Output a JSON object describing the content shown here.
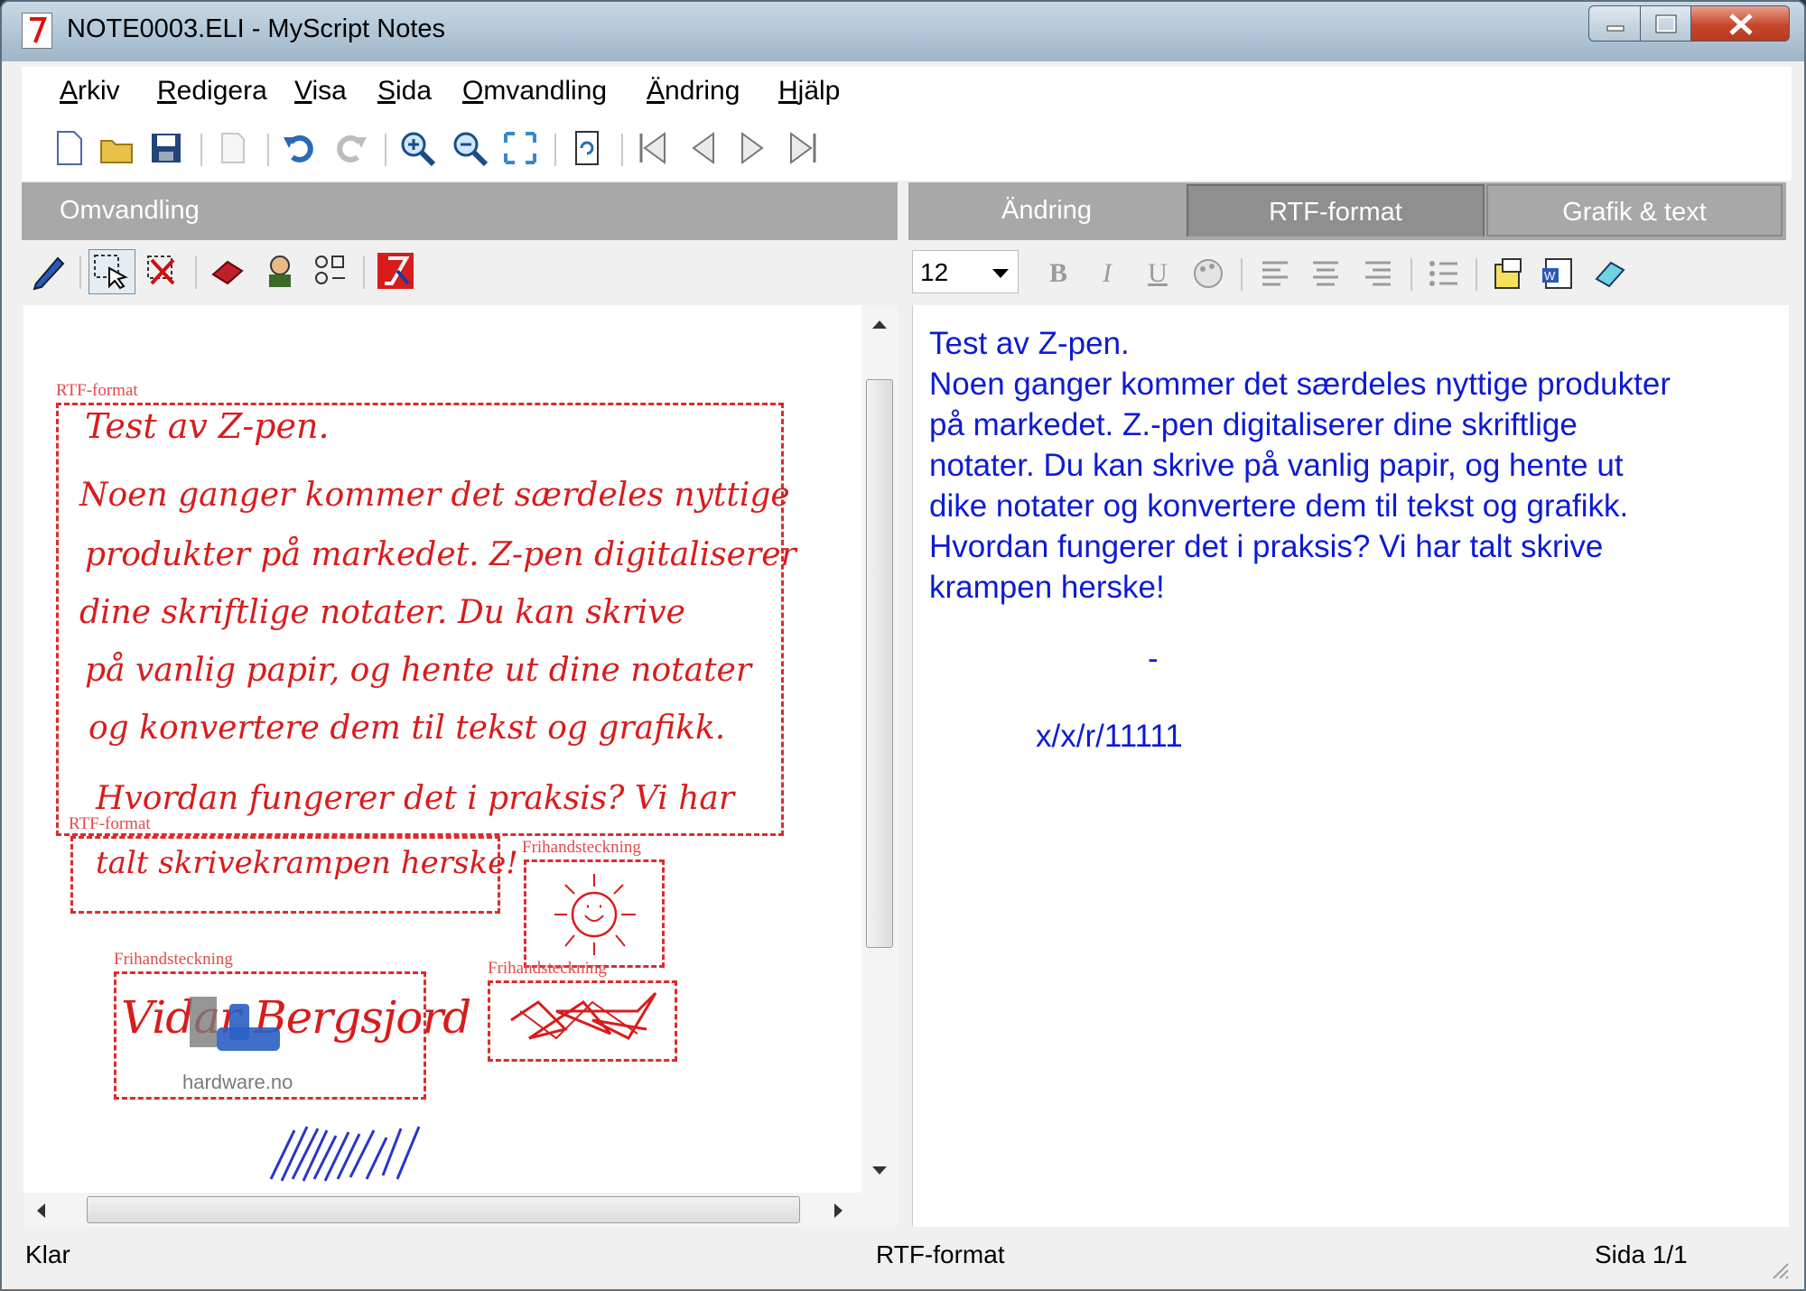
{
  "window": {
    "title": "NOTE0003.ELI - MyScript Notes"
  },
  "menu": [
    "Arkiv",
    "Redigera",
    "Visa",
    "Sida",
    "Omvandling",
    "Ändring",
    "Hjälp"
  ],
  "toolbar_icons": [
    "new-icon",
    "open-icon",
    "save-icon",
    "export-icon",
    "undo-icon",
    "redo-icon",
    "zoom-in-icon",
    "zoom-out-icon",
    "fit-icon",
    "refresh-icon",
    "first-page-icon",
    "prev-page-icon",
    "next-page-icon",
    "last-page-icon"
  ],
  "left_panel": {
    "header": "Omvandling",
    "tools": [
      "pen-icon",
      "select-icon",
      "delete-icon",
      "eraser-icon",
      "person-icon",
      "shapes-icon",
      "myscript-icon"
    ],
    "box_labels": {
      "rtf1": "RTF-format",
      "rtf2": "RTF-format",
      "draw1": "Frihandsteckning",
      "draw2": "Frihandsteckning",
      "draw3": "Frihandsteckning"
    },
    "handwriting": [
      "Test av Z-pen.",
      "Noen ganger kommer det særdeles nyttige",
      "produkter på markedet. Z-pen digitaliserer",
      "dine skriftlige notater. Du kan skrive",
      "på vanlig papir, og hente ut dine notater",
      "og konvertere dem til tekst og grafikk.",
      "Hvordan fungerer det i praksis? Vi har",
      "talt skrivekrampen herske!"
    ],
    "signature": "Vidar Bergsjord",
    "watermark": "hardware.no"
  },
  "right_panel": {
    "tabs": [
      "Ändring",
      "RTF-format",
      "Grafik & text"
    ],
    "active_tab": "RTF-format",
    "font_size": "12",
    "rtf_lines": [
      "Test av Z-pen.",
      "Noen ganger kommer det særdeles nyttige produkter",
      "på markedet. Z.-pen digitaliserer dine skriftlige",
      "notater. Du kan skrive på vanlig papir, og hente ut",
      "dike notater og konvertere dem til tekst og grafikk.",
      "Hvordan fungerer det i praksis? Vi har talt skrive",
      "krampen herske!"
    ],
    "dash": "-",
    "code": "x/x/r/11111",
    "text_color": "#0d1bd4"
  },
  "status": {
    "left": "Klar",
    "center": "RTF-format",
    "right": "Sida 1/1"
  },
  "colors": {
    "ink_red": "#d81c1c",
    "ink_blue": "#2a35c9",
    "header_gray": "#a8a8a8"
  }
}
